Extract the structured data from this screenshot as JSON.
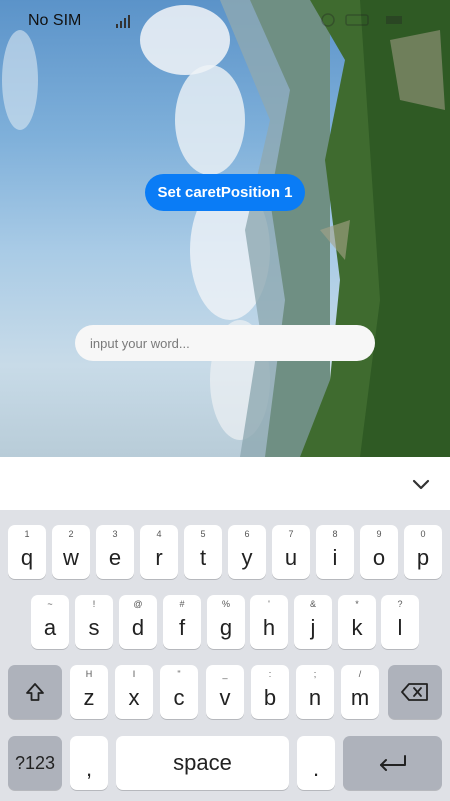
{
  "status_bar": {
    "carrier": "No SIM"
  },
  "button": {
    "label": "Set caretPosition 1"
  },
  "input": {
    "placeholder": "input your word...",
    "value": ""
  },
  "keyboard": {
    "row1": [
      {
        "hint": "1",
        "key": "q"
      },
      {
        "hint": "2",
        "key": "w"
      },
      {
        "hint": "3",
        "key": "e"
      },
      {
        "hint": "4",
        "key": "r"
      },
      {
        "hint": "5",
        "key": "t"
      },
      {
        "hint": "6",
        "key": "y"
      },
      {
        "hint": "7",
        "key": "u"
      },
      {
        "hint": "8",
        "key": "i"
      },
      {
        "hint": "9",
        "key": "o"
      },
      {
        "hint": "0",
        "key": "p"
      }
    ],
    "row2": [
      {
        "hint": "~",
        "key": "a"
      },
      {
        "hint": "!",
        "key": "s"
      },
      {
        "hint": "@",
        "key": "d"
      },
      {
        "hint": "#",
        "key": "f"
      },
      {
        "hint": "%",
        "key": "g"
      },
      {
        "hint": "'",
        "key": "h"
      },
      {
        "hint": "&",
        "key": "j"
      },
      {
        "hint": "*",
        "key": "k"
      },
      {
        "hint": "?",
        "key": "l"
      }
    ],
    "row3": [
      {
        "hint": "H",
        "key": "z"
      },
      {
        "hint": "I",
        "key": "x"
      },
      {
        "hint": "\"",
        "key": "c"
      },
      {
        "hint": "_",
        "key": "v"
      },
      {
        "hint": ":",
        "key": "b"
      },
      {
        "hint": ";",
        "key": "n"
      },
      {
        "hint": "/",
        "key": "m"
      }
    ],
    "symbols_label": "?123",
    "comma_label": ",",
    "space_label": "space",
    "period_label": "."
  },
  "colors": {
    "accent": "#0a7cf6",
    "keyboard_bg": "#dfe1e6",
    "func_key": "#aeb2bb"
  }
}
